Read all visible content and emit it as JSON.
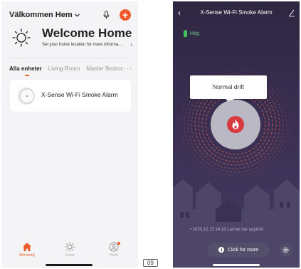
{
  "home_screen": {
    "home_selector": {
      "label": "Välkommen Hem",
      "icon": "chevron-down-icon"
    },
    "actions": {
      "mic_icon": "microphone-icon",
      "add_icon": "plus-icon",
      "add_glyph": "+"
    },
    "welcome": {
      "title": "Welcome Home",
      "subtitle": "Set your home location for more informa...",
      "arrow": "›"
    },
    "tabs": [
      {
        "label": "Alla enheter",
        "active": true
      },
      {
        "label": "Living Room",
        "active": false
      },
      {
        "label": "Master Bedroc",
        "active": false
      }
    ],
    "tabs_more": "···",
    "devices": [
      {
        "name": "X-Sense Wi-Fi Smoke Alarm",
        "icon": "smoke-alarm-icon"
      }
    ],
    "bottom_nav": [
      {
        "label": "Mitt hemlj",
        "icon": "home-icon",
        "active": true
      },
      {
        "label": "Smart",
        "icon": "sun-icon",
        "active": false
      },
      {
        "label": "Profil",
        "icon": "profile-icon",
        "active": false
      }
    ]
  },
  "page_number": "09",
  "device_screen": {
    "title": "X-Sense Wi-Fi Smoke Alarm",
    "back_glyph": "‹",
    "battery_label": "Hög",
    "status_text": "Normal drift",
    "event_log": "2020.12.15 14:18 Larmet har upphört",
    "click_more_label": "Click for more"
  },
  "colors": {
    "accent": "#f05a2a",
    "alarm_red": "#d73a3f",
    "battery_green": "#3fbf5f",
    "device_bg": "#3a2f52"
  }
}
